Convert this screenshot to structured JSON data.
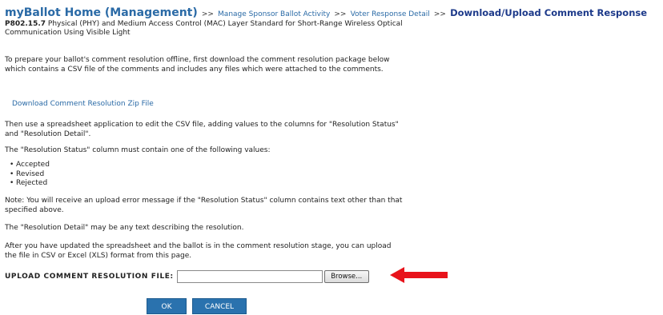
{
  "breadcrumb": {
    "home": "myBallot Home (Management)",
    "sep": ">>",
    "items": [
      "Manage Sponsor Ballot Activity",
      "Voter Response Detail"
    ],
    "current": "Download/Upload Comment Response"
  },
  "subtitle": {
    "code": "P802.15.7",
    "text": "Physical (PHY) and Medium Access Control (MAC) Layer Standard for Short-Range Wireless Optical Communication Using Visible Light"
  },
  "instructions": {
    "p1": "To prepare your ballot's comment resolution offline, first download the comment resolution package below which contains a CSV file of the comments and includes any files which were attached to the comments.",
    "download_link": "Download Comment Resolution Zip File",
    "p2": "Then use a spreadsheet application to edit the CSV file, adding values to the columns for \"Resolution Status\" and \"Resolution Detail\".",
    "p3": "The \"Resolution Status\" column must contain one of the following values:",
    "values": [
      "Accepted",
      "Revised",
      "Rejected"
    ],
    "p4": "Note: You will receive an upload error message if the \"Resolution Status\" column contains text other than that specified above.",
    "p5": "The \"Resolution Detail\" may be any text describing the resolution.",
    "p6": "After you have updated the spreadsheet and the ballot is in the comment resolution stage, you can upload the file in CSV or Excel (XLS) format from this page."
  },
  "upload": {
    "label": "UPLOAD COMMENT RESOLUTION FILE:",
    "file_value": "",
    "browse_label": "Browse..."
  },
  "buttons": {
    "ok": "OK",
    "cancel": "CANCEL"
  },
  "colors": {
    "link": "#2a6aa6",
    "button": "#2a72ae",
    "arrow": "#e8131b"
  }
}
